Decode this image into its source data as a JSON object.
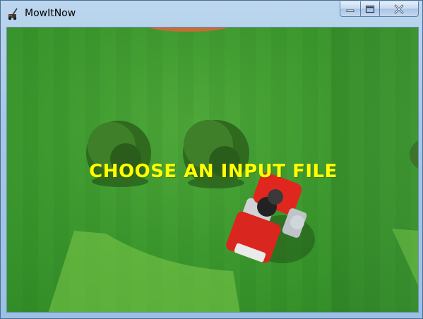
{
  "window": {
    "title": "MowItNow"
  },
  "main": {
    "prompt": "CHOOSE AN INPUT FILE"
  },
  "colors": {
    "prompt_text": "#ffff00",
    "grass": "#3e9a2f"
  },
  "icons": {
    "app": "lawn-mower-icon",
    "minimize": "minimize-icon",
    "maximize": "maximize-icon",
    "close": "close-icon"
  }
}
